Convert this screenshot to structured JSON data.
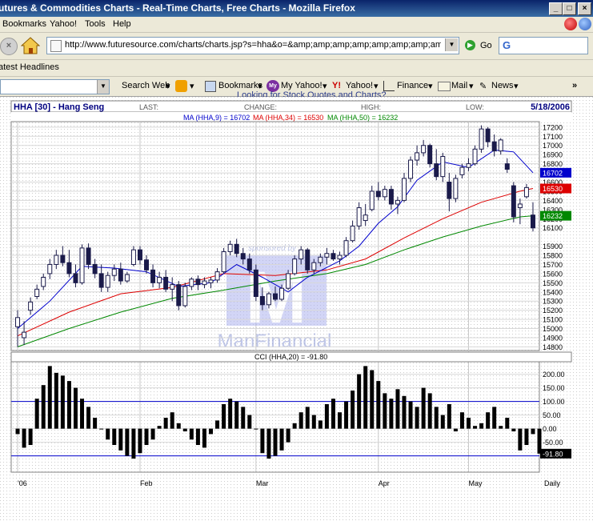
{
  "window": {
    "title": "utures & Commodities Charts - Real-Time Charts, Free Charts - Mozilla Firefox"
  },
  "menu": {
    "items": [
      "Bookmarks",
      "Yahoo!",
      "Tools",
      "Help"
    ]
  },
  "address": {
    "url": "http://www.futuresource.com/charts/charts.jsp?s=hha&o=&amp;amp;amp;amp;amp;amp;amp;amp;amp;a=D&",
    "go_label": "Go",
    "search_value": "G"
  },
  "headlines": {
    "label": "atest Headlines"
  },
  "yahoo_toolbar": {
    "search_web": "Search Web",
    "bookmarks": "Bookmarks",
    "my_yahoo": "My Yahoo!",
    "yahoo": "Yahoo!",
    "finance": "Finance",
    "mail": "Mail",
    "news": "News",
    "more": "»"
  },
  "banner": {
    "partial_text": "Looking for Stock Quotes and Charts?"
  },
  "chart_header": {
    "symbol": "HHA [30] - Hang Seng",
    "last_label": "LAST:",
    "change_label": "CHANGE:",
    "high_label": "HIGH:",
    "low_label": "LOW:",
    "date": "5/18/2006",
    "ma_line": [
      {
        "text": "MA (HHA,9) = 16702",
        "color": "#0000cc"
      },
      {
        "text": "MA (HHA,34) = 16530",
        "color": "#dd0000"
      },
      {
        "text": "MA (HHA,50) = 16232",
        "color": "#008800"
      }
    ]
  },
  "watermark": {
    "sponsored": "sponsored by",
    "brand": "ManFinancial",
    "logo_letter": "M"
  },
  "cci_title": "CCI (HHA,20) = -91.80",
  "chart_data": {
    "type": "candlestick",
    "price_axis": {
      "ticks": [
        17200,
        17100,
        17000,
        16900,
        16800,
        16700,
        16600,
        16500,
        16400,
        16300,
        16200,
        16100,
        15900,
        15800,
        15700,
        15600,
        15500,
        15400,
        15300,
        15200,
        15100,
        15000,
        14900,
        14800
      ],
      "range": [
        14760,
        17260
      ]
    },
    "price_markers": [
      {
        "value": 16702,
        "label": "16702",
        "color": "#0000cc"
      },
      {
        "value": 16530,
        "label": "16530",
        "color": "#dd0000"
      },
      {
        "value": 16232,
        "label": "16232",
        "color": "#008800"
      }
    ],
    "cci_axis": {
      "ticks": [
        "200.00",
        "150.00",
        "100.00",
        "50.00",
        "0.00",
        "-50.00"
      ],
      "range": [
        -160,
        240
      ],
      "current": -91.8,
      "current_label": "-91.80"
    },
    "x_labels": [
      "'06",
      "Feb",
      "Mar",
      "Apr",
      "May",
      "Daily"
    ],
    "bars": [
      {
        "o": 15020,
        "h": 15200,
        "l": 14800,
        "c": 15120
      },
      {
        "o": 14900,
        "h": 15080,
        "l": 14820,
        "c": 14960
      },
      {
        "o": 15200,
        "h": 15340,
        "l": 15150,
        "c": 15290
      },
      {
        "o": 15350,
        "h": 15480,
        "l": 15320,
        "c": 15430
      },
      {
        "o": 15460,
        "h": 15600,
        "l": 15420,
        "c": 15560
      },
      {
        "o": 15600,
        "h": 15760,
        "l": 15540,
        "c": 15700
      },
      {
        "o": 15700,
        "h": 15860,
        "l": 15650,
        "c": 15800
      },
      {
        "o": 15800,
        "h": 15900,
        "l": 15680,
        "c": 15720
      },
      {
        "o": 15720,
        "h": 15860,
        "l": 15560,
        "c": 15600
      },
      {
        "o": 15600,
        "h": 15700,
        "l": 15450,
        "c": 15500
      },
      {
        "o": 15500,
        "h": 15920,
        "l": 15480,
        "c": 15880
      },
      {
        "o": 15880,
        "h": 15930,
        "l": 15650,
        "c": 15700
      },
      {
        "o": 15700,
        "h": 15760,
        "l": 15550,
        "c": 15600
      },
      {
        "o": 15600,
        "h": 15700,
        "l": 15400,
        "c": 15450
      },
      {
        "o": 15450,
        "h": 15620,
        "l": 15400,
        "c": 15580
      },
      {
        "o": 15580,
        "h": 15700,
        "l": 15520,
        "c": 15650
      },
      {
        "o": 15650,
        "h": 15720,
        "l": 15480,
        "c": 15520
      },
      {
        "o": 15520,
        "h": 15620,
        "l": 15500,
        "c": 15590
      },
      {
        "o": 15700,
        "h": 15900,
        "l": 15680,
        "c": 15860
      },
      {
        "o": 15860,
        "h": 15900,
        "l": 15700,
        "c": 15750
      },
      {
        "o": 15750,
        "h": 15800,
        "l": 15600,
        "c": 15640
      },
      {
        "o": 15640,
        "h": 15700,
        "l": 15450,
        "c": 15500
      },
      {
        "o": 15500,
        "h": 15620,
        "l": 15440,
        "c": 15560
      },
      {
        "o": 15560,
        "h": 15640,
        "l": 15400,
        "c": 15430
      },
      {
        "o": 15430,
        "h": 15560,
        "l": 15300,
        "c": 15480
      },
      {
        "o": 15480,
        "h": 15520,
        "l": 15200,
        "c": 15250
      },
      {
        "o": 15250,
        "h": 15500,
        "l": 15230,
        "c": 15460
      },
      {
        "o": 15460,
        "h": 15560,
        "l": 15420,
        "c": 15540
      },
      {
        "o": 15540,
        "h": 15580,
        "l": 15420,
        "c": 15480
      },
      {
        "o": 15480,
        "h": 15560,
        "l": 15440,
        "c": 15520
      },
      {
        "o": 15500,
        "h": 15560,
        "l": 15440,
        "c": 15530
      },
      {
        "o": 15530,
        "h": 15660,
        "l": 15500,
        "c": 15620
      },
      {
        "o": 15620,
        "h": 15880,
        "l": 15600,
        "c": 15840
      },
      {
        "o": 15840,
        "h": 15960,
        "l": 15800,
        "c": 15920
      },
      {
        "o": 15920,
        "h": 15980,
        "l": 15780,
        "c": 15820
      },
      {
        "o": 15820,
        "h": 15880,
        "l": 15700,
        "c": 15760
      },
      {
        "o": 15760,
        "h": 15820,
        "l": 15600,
        "c": 15640
      },
      {
        "o": 15640,
        "h": 15700,
        "l": 15300,
        "c": 15350
      },
      {
        "o": 15350,
        "h": 15450,
        "l": 15200,
        "c": 15260
      },
      {
        "o": 15260,
        "h": 15400,
        "l": 15220,
        "c": 15380
      },
      {
        "o": 15380,
        "h": 15460,
        "l": 15300,
        "c": 15320
      },
      {
        "o": 15320,
        "h": 15480,
        "l": 15300,
        "c": 15440
      },
      {
        "o": 15440,
        "h": 15640,
        "l": 15420,
        "c": 15600
      },
      {
        "o": 15600,
        "h": 15800,
        "l": 15580,
        "c": 15760
      },
      {
        "o": 15760,
        "h": 15900,
        "l": 15700,
        "c": 15860
      },
      {
        "o": 15860,
        "h": 15880,
        "l": 15600,
        "c": 15640
      },
      {
        "o": 15640,
        "h": 15760,
        "l": 15600,
        "c": 15720
      },
      {
        "o": 15720,
        "h": 15820,
        "l": 15680,
        "c": 15780
      },
      {
        "o": 15780,
        "h": 15880,
        "l": 15700,
        "c": 15820
      },
      {
        "o": 15820,
        "h": 15860,
        "l": 15740,
        "c": 15760
      },
      {
        "o": 15760,
        "h": 15840,
        "l": 15700,
        "c": 15800
      },
      {
        "o": 15800,
        "h": 16000,
        "l": 15780,
        "c": 15960
      },
      {
        "o": 15960,
        "h": 16180,
        "l": 15940,
        "c": 16120
      },
      {
        "o": 16120,
        "h": 16380,
        "l": 16080,
        "c": 16320
      },
      {
        "o": 16180,
        "h": 16360,
        "l": 16120,
        "c": 16240
      },
      {
        "o": 16300,
        "h": 16560,
        "l": 16280,
        "c": 16500
      },
      {
        "o": 16500,
        "h": 16600,
        "l": 16400,
        "c": 16440
      },
      {
        "o": 16440,
        "h": 16560,
        "l": 16400,
        "c": 16520
      },
      {
        "o": 16520,
        "h": 16560,
        "l": 16300,
        "c": 16360
      },
      {
        "o": 16360,
        "h": 16440,
        "l": 16250,
        "c": 16400
      },
      {
        "o": 16400,
        "h": 16700,
        "l": 16380,
        "c": 16640
      },
      {
        "o": 16640,
        "h": 16880,
        "l": 16600,
        "c": 16840
      },
      {
        "o": 16840,
        "h": 17000,
        "l": 16780,
        "c": 16920
      },
      {
        "o": 16920,
        "h": 17060,
        "l": 16880,
        "c": 17000
      },
      {
        "o": 17000,
        "h": 17020,
        "l": 16760,
        "c": 16800
      },
      {
        "o": 16800,
        "h": 16960,
        "l": 16620,
        "c": 16660
      },
      {
        "o": 16660,
        "h": 16920,
        "l": 16600,
        "c": 16880
      },
      {
        "o": 16600,
        "h": 16700,
        "l": 16280,
        "c": 16420
      },
      {
        "o": 16420,
        "h": 16680,
        "l": 16380,
        "c": 16640
      },
      {
        "o": 16680,
        "h": 16800,
        "l": 16640,
        "c": 16760
      },
      {
        "o": 16760,
        "h": 16860,
        "l": 16720,
        "c": 16800
      },
      {
        "o": 16800,
        "h": 17000,
        "l": 16780,
        "c": 16960
      },
      {
        "o": 16960,
        "h": 17220,
        "l": 16920,
        "c": 17180
      },
      {
        "o": 17180,
        "h": 17200,
        "l": 16980,
        "c": 17040
      },
      {
        "o": 17040,
        "h": 17120,
        "l": 16880,
        "c": 16940
      },
      {
        "o": 16940,
        "h": 17080,
        "l": 16900,
        "c": 17060
      },
      {
        "o": 16800,
        "h": 16860,
        "l": 16700,
        "c": 16740
      },
      {
        "o": 16560,
        "h": 16600,
        "l": 16160,
        "c": 16220
      },
      {
        "o": 16320,
        "h": 16420,
        "l": 16140,
        "c": 16360
      },
      {
        "o": 16440,
        "h": 16580,
        "l": 16420,
        "c": 16540
      },
      {
        "o": 16240,
        "h": 16380,
        "l": 16060,
        "c": 16100
      }
    ],
    "ma9": [
      [
        0,
        15000
      ],
      [
        5,
        15300
      ],
      [
        10,
        15680
      ],
      [
        15,
        15660
      ],
      [
        20,
        15620
      ],
      [
        25,
        15460
      ],
      [
        30,
        15500
      ],
      [
        34,
        15700
      ],
      [
        38,
        15560
      ],
      [
        42,
        15400
      ],
      [
        45,
        15560
      ],
      [
        50,
        15740
      ],
      [
        53,
        15900
      ],
      [
        56,
        16150
      ],
      [
        59,
        16330
      ],
      [
        62,
        16620
      ],
      [
        66,
        16820
      ],
      [
        70,
        16760
      ],
      [
        74,
        16950
      ],
      [
        77,
        16930
      ],
      [
        80,
        16702
      ]
    ],
    "ma34": [
      [
        0,
        14920
      ],
      [
        8,
        15180
      ],
      [
        16,
        15380
      ],
      [
        24,
        15450
      ],
      [
        32,
        15600
      ],
      [
        40,
        15580
      ],
      [
        48,
        15640
      ],
      [
        54,
        15760
      ],
      [
        60,
        15990
      ],
      [
        66,
        16200
      ],
      [
        72,
        16380
      ],
      [
        78,
        16500
      ],
      [
        80,
        16530
      ]
    ],
    "ma50": [
      [
        0,
        14800
      ],
      [
        8,
        15000
      ],
      [
        16,
        15180
      ],
      [
        24,
        15330
      ],
      [
        32,
        15420
      ],
      [
        40,
        15520
      ],
      [
        48,
        15600
      ],
      [
        54,
        15700
      ],
      [
        60,
        15860
      ],
      [
        66,
        16000
      ],
      [
        72,
        16120
      ],
      [
        78,
        16220
      ],
      [
        80,
        16232
      ]
    ],
    "cci": [
      -20,
      -70,
      -60,
      110,
      160,
      230,
      205,
      195,
      175,
      150,
      110,
      80,
      40,
      0,
      -40,
      -60,
      -80,
      -100,
      -110,
      -90,
      -60,
      -40,
      10,
      40,
      60,
      20,
      -10,
      -40,
      -60,
      -70,
      -20,
      30,
      90,
      110,
      100,
      80,
      50,
      0,
      -90,
      -110,
      -100,
      -80,
      -50,
      20,
      60,
      80,
      50,
      30,
      90,
      110,
      60,
      100,
      140,
      200,
      230,
      215,
      175,
      130,
      110,
      145,
      120,
      100,
      80,
      150,
      130,
      80,
      50,
      90,
      -10,
      60,
      40,
      10,
      20,
      60,
      80,
      10,
      40,
      -10,
      -80,
      -60,
      -20,
      -91.8
    ]
  }
}
